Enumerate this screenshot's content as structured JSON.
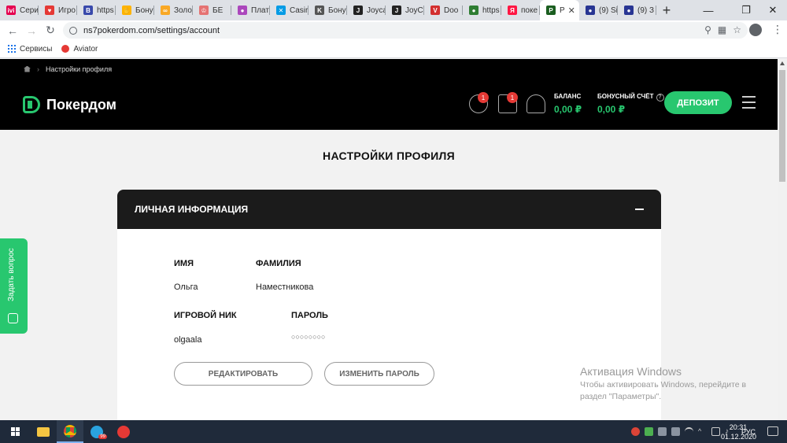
{
  "browser": {
    "tabs": [
      {
        "label": "Сери",
        "color": "#e5004f",
        "glyph": "ivi"
      },
      {
        "label": "Игро",
        "color": "#e53935",
        "glyph": "♥"
      },
      {
        "label": "https",
        "color": "#3949ab",
        "glyph": "B"
      },
      {
        "label": "Бону",
        "color": "#ffb300",
        "glyph": "✋"
      },
      {
        "label": "Золо",
        "color": "#f9a825",
        "glyph": "∞"
      },
      {
        "label": "БЕ",
        "color": "#e57373",
        "glyph": "♔"
      },
      {
        "label": "Плат",
        "color": "#ab47bc",
        "glyph": "●"
      },
      {
        "label": "Casir",
        "color": "#039be5",
        "glyph": "✕"
      },
      {
        "label": "Бону",
        "color": "#555555",
        "glyph": "K"
      },
      {
        "label": "Joyca",
        "color": "#222222",
        "glyph": "J"
      },
      {
        "label": "JoyC",
        "color": "#222222",
        "glyph": "J"
      },
      {
        "label": "Doo",
        "color": "#d32f2f",
        "glyph": "V"
      },
      {
        "label": "https",
        "color": "#2e7d32",
        "glyph": "●"
      },
      {
        "label": "поке",
        "color": "#ff1744",
        "glyph": "Я"
      },
      {
        "label": "P",
        "color": "#1b5e20",
        "glyph": "P"
      },
      {
        "label": "(9) Si",
        "color": "#283593",
        "glyph": "●"
      },
      {
        "label": "(9) З",
        "color": "#283593",
        "glyph": "●"
      }
    ],
    "new_tab": "+",
    "close_tab": "✕",
    "minimize": "—",
    "maximize": "❐",
    "close_window": "✕",
    "url": "ns7pokerdom.com/settings/account",
    "bookmarks": [
      {
        "label": "Сервисы"
      },
      {
        "label": "Aviator"
      }
    ]
  },
  "site": {
    "breadcrumb": "Настройки профиля",
    "logo_text": "Покердом",
    "badges": {
      "target": "1",
      "basket": "1"
    },
    "balance_label": "БАЛАНС",
    "balance_value": "0,00 ₽",
    "bonus_label": "БОНУСНЫЙ СЧЁТ",
    "bonus_value": "0,00 ₽",
    "bonus_help": "?",
    "deposit_label": "ДЕПОЗИТ"
  },
  "main": {
    "page_title": "НАСТРОЙКИ ПРОФИЛЯ",
    "section_title": "ЛИЧНАЯ ИНФОРМАЦИЯ",
    "fields": {
      "first_name_label": "ИМЯ",
      "first_name_value": "Ольга",
      "last_name_label": "ФАМИЛИЯ",
      "last_name_value": "Наместникова",
      "nick_label": "ИГРОВОЙ НИК",
      "nick_value": "olgaala",
      "password_label": "ПАРОЛЬ",
      "password_value": "○○○○○○○○"
    },
    "edit_button": "РЕДАКТИРОВАТЬ",
    "change_password_button": "ИЗМЕНИТЬ ПАРОЛЬ"
  },
  "ask_question": "Задать вопрос",
  "windows_activation": {
    "title": "Активация Windows",
    "text": "Чтобы активировать Windows, перейдите в раздел \"Параметры\"."
  },
  "taskbar": {
    "apps": [
      {
        "name": "file-explorer",
        "color": "#f4c542"
      },
      {
        "name": "chrome",
        "color": "#db4437"
      },
      {
        "name": "telegram",
        "color": "#2aa3df"
      },
      {
        "name": "pokerdom-app",
        "color": "#e53935"
      }
    ],
    "telegram_badge": "99",
    "language": "РУС",
    "time": "20:31",
    "date": "01.12.2020"
  }
}
